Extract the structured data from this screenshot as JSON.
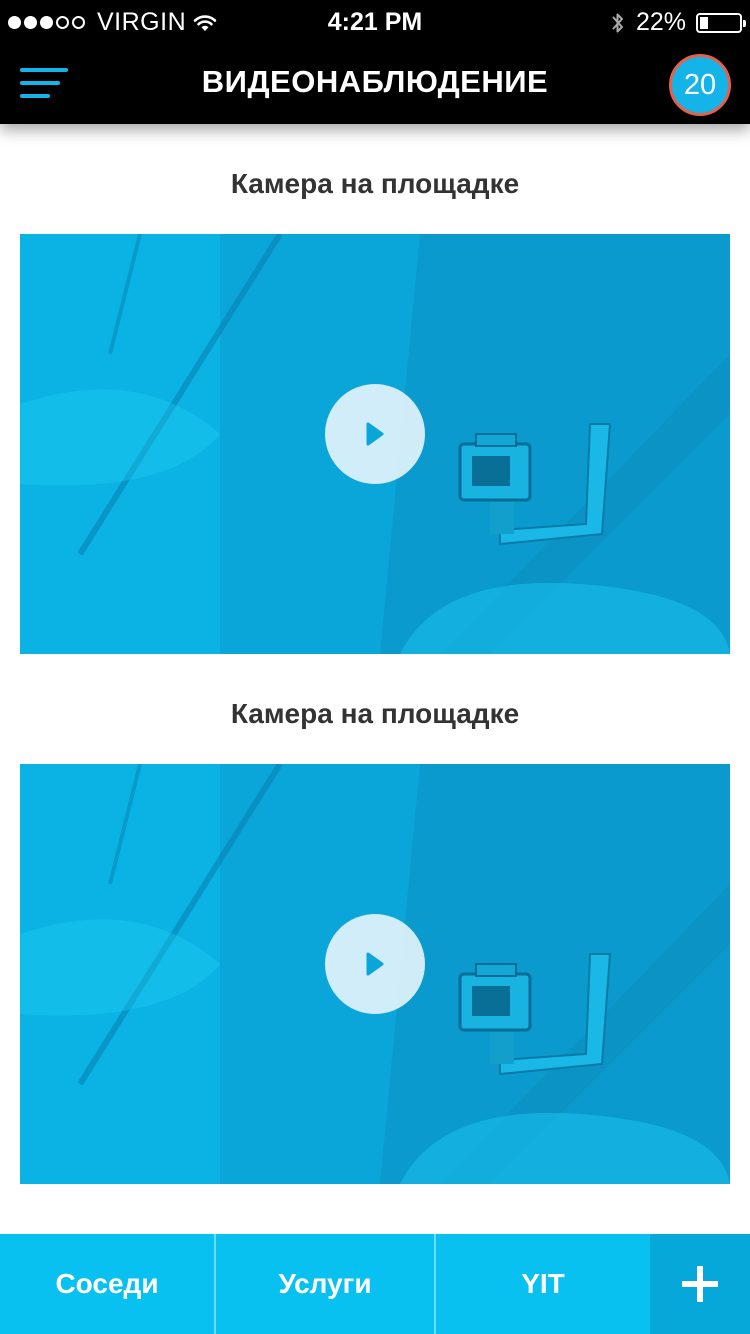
{
  "status_bar": {
    "carrier": "VIRGIN",
    "time": "4:21 PM",
    "battery": "22%",
    "battery_level": 0.22,
    "signal_bars_filled": 3,
    "signal_bars_total": 5
  },
  "header": {
    "title": "ВИДЕОНАБЛЮДЕНИЕ",
    "notification_count": "20",
    "menu_icon": "hamburger-menu-icon"
  },
  "cameras": [
    {
      "title": "Камера на площадке"
    },
    {
      "title": "Камера на площадке"
    }
  ],
  "tabs": [
    {
      "label": "Соседи"
    },
    {
      "label": "Услуги"
    },
    {
      "label": "YIT"
    },
    {
      "label": "+"
    }
  ],
  "colors": {
    "accent": "#14b3e8",
    "badge_border": "#e8604a",
    "tab_bar": "#08c1f0",
    "tab_plus": "#06a8d9"
  }
}
